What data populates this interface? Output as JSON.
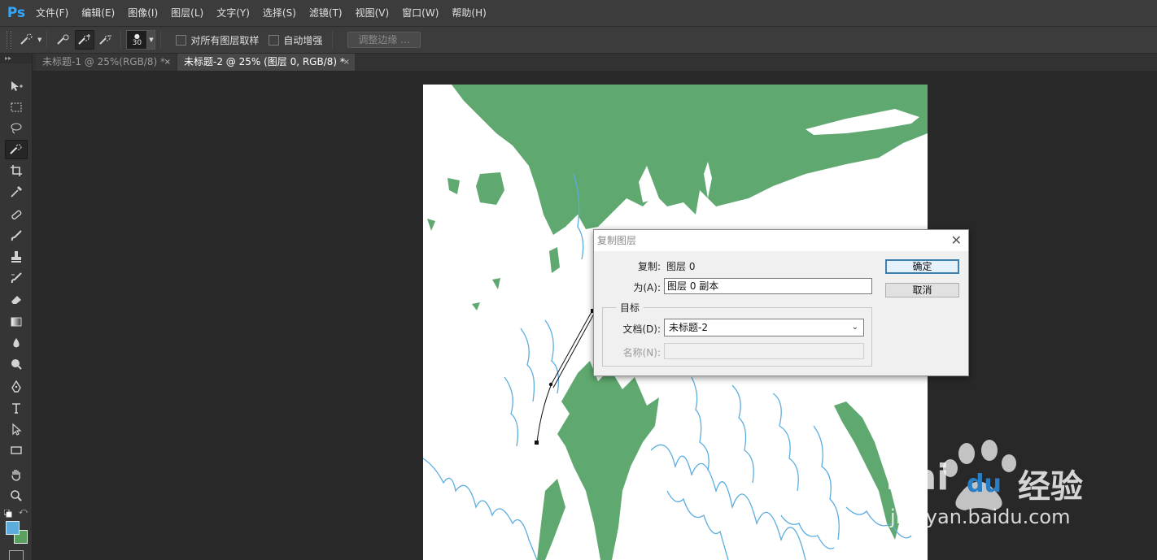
{
  "app": {
    "logo": "Ps"
  },
  "menu": [
    "文件(F)",
    "编辑(E)",
    "图像(I)",
    "图层(L)",
    "文字(Y)",
    "选择(S)",
    "滤镜(T)",
    "视图(V)",
    "窗口(W)",
    "帮助(H)"
  ],
  "options": {
    "brush_size": "30",
    "sample_all_layers": "对所有图层取样",
    "auto_enhance": "自动增强",
    "refine_edge": "调整边缘 ..."
  },
  "tabs": [
    {
      "label": "未标题-1 @ 25%(RGB/8) *",
      "close": "×"
    },
    {
      "label": "未标题-2 @ 25% (图层 0, RGB/8) *",
      "close": "×"
    }
  ],
  "toolbar": {
    "collapse": "▸▸",
    "fg_color": "#5cadde",
    "bg_color": "#5aa061"
  },
  "dialog": {
    "title": "复制图层",
    "close": "✕",
    "duplicate_label": "复制:",
    "duplicate_value": "图层 0",
    "as_label": "为(A):",
    "as_value": "图层 0 副本",
    "group_title": "目标",
    "document_label": "文档(D):",
    "document_value": "未标题-2",
    "name_label": "名称(N):",
    "name_value": "",
    "ok": "确定",
    "cancel": "取消"
  },
  "watermark": {
    "brand": "Bai",
    "brand_tail": "du",
    "product": "经验",
    "url": "jingyan.baidu.com"
  }
}
